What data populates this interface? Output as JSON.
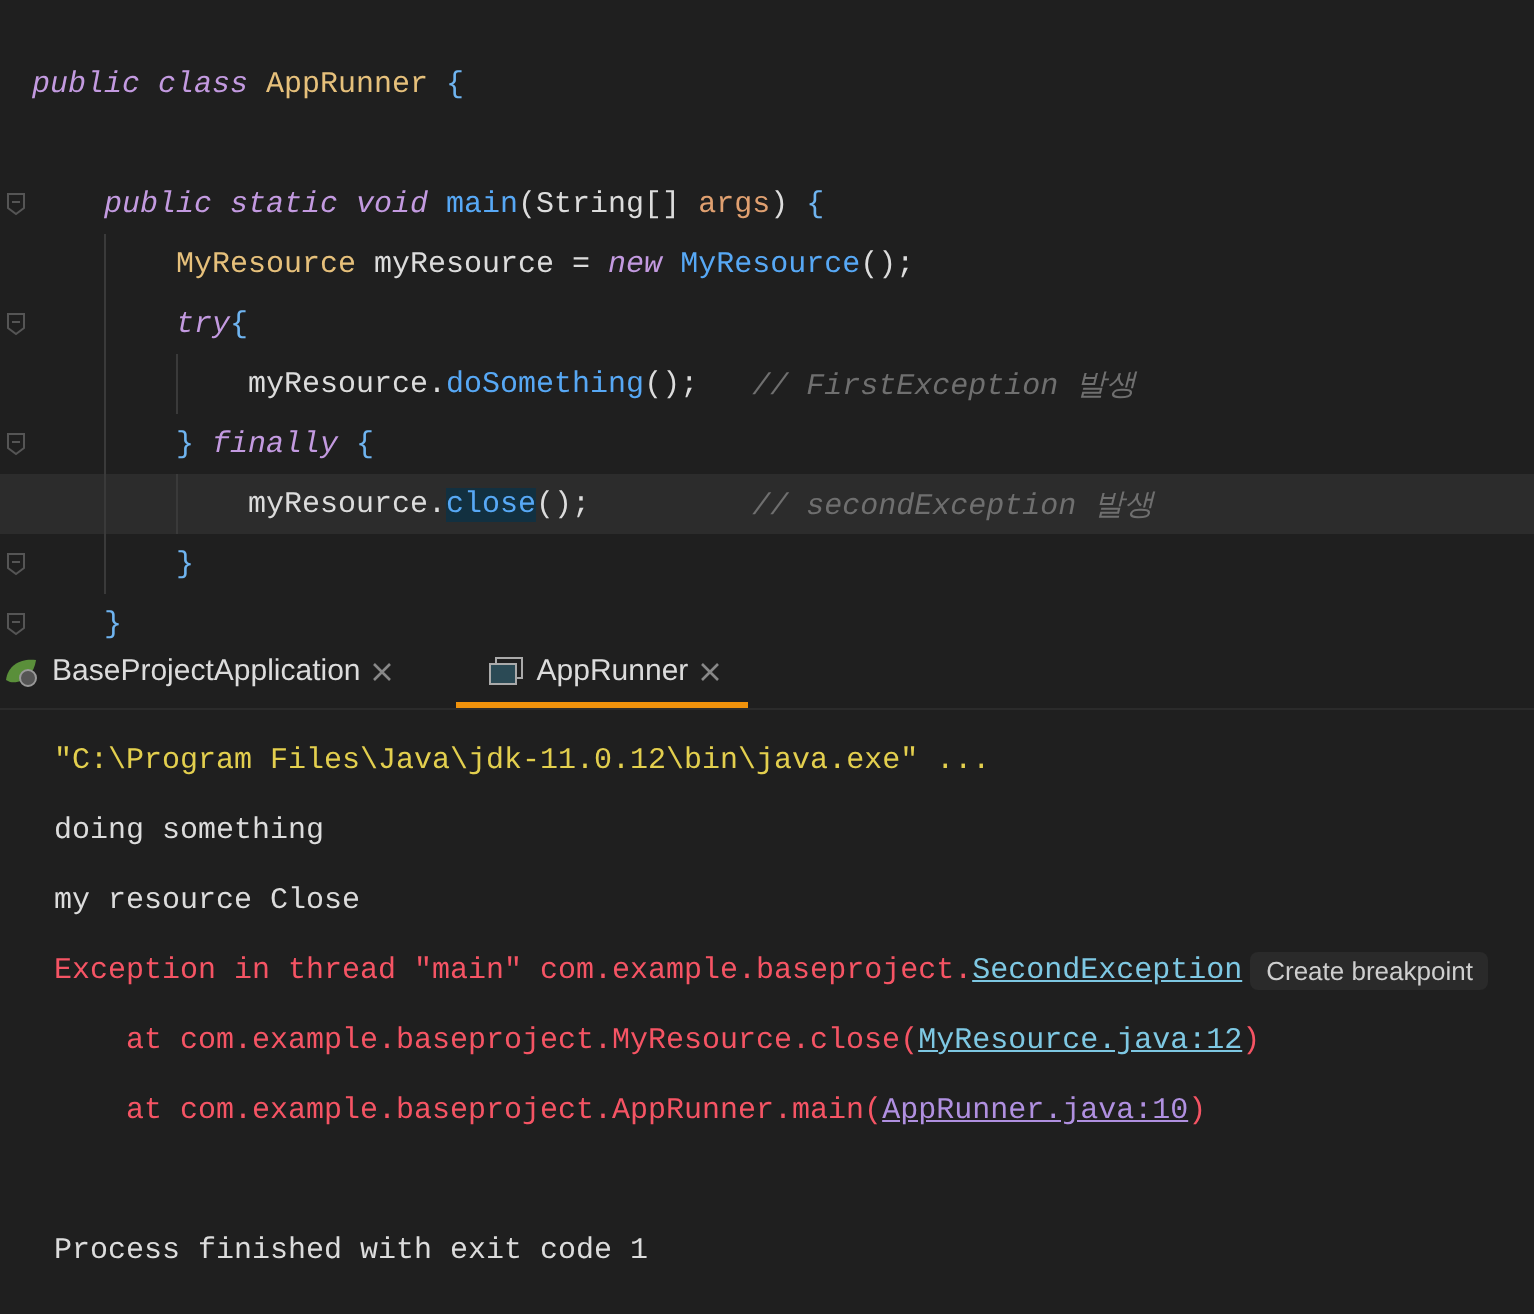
{
  "editor": {
    "lines": [
      {
        "fold": false,
        "current": false,
        "tokens": [
          {
            "kind": "keyword",
            "text": "public class "
          },
          {
            "kind": "class",
            "text": "AppRunner"
          },
          {
            "kind": "brace",
            "text": " {"
          }
        ],
        "children": [
          {
            "fold": false,
            "current": false
          },
          {
            "fold": true,
            "current": false,
            "tokens": [
              {
                "kind": "keyword",
                "text": "public static void "
              },
              {
                "kind": "method",
                "text": "main"
              },
              {
                "kind": "plain",
                "text": "(String[] "
              },
              {
                "kind": "param",
                "text": "args"
              },
              {
                "kind": "plain",
                "text": ") "
              },
              {
                "kind": "brace",
                "text": "{"
              }
            ],
            "children": [
              {
                "fold": false,
                "current": false,
                "tokens": [
                  {
                    "kind": "class",
                    "text": "MyResource"
                  },
                  {
                    "kind": "plain",
                    "text": " myResource = "
                  },
                  {
                    "kind": "keyword",
                    "text": "new "
                  },
                  {
                    "kind": "method",
                    "text": "MyResource"
                  },
                  {
                    "kind": "plain",
                    "text": "();"
                  }
                ]
              },
              {
                "fold": true,
                "current": false,
                "tokens": [
                  {
                    "kind": "keyword",
                    "text": "try"
                  },
                  {
                    "kind": "brace",
                    "text": "{"
                  }
                ],
                "children": [
                  {
                    "fold": false,
                    "current": false,
                    "tokens": [
                      {
                        "kind": "plain",
                        "text": "myResource."
                      },
                      {
                        "kind": "method",
                        "text": "doSomething"
                      },
                      {
                        "kind": "plain",
                        "text": "();   "
                      },
                      {
                        "kind": "comment",
                        "text": "// FirstException 발생"
                      }
                    ]
                  }
                ]
              },
              {
                "fold": true,
                "current": false,
                "tokens": [
                  {
                    "kind": "brace",
                    "text": "} "
                  },
                  {
                    "kind": "keyword",
                    "text": "finally "
                  },
                  {
                    "kind": "brace",
                    "text": "{"
                  }
                ],
                "children": [
                  {
                    "fold": false,
                    "current": true,
                    "tokens": [
                      {
                        "kind": "plain",
                        "text": "myResource."
                      },
                      {
                        "kind": "highlight",
                        "text": "close"
                      },
                      {
                        "kind": "plain",
                        "text": "();         "
                      },
                      {
                        "kind": "comment",
                        "text": "// secondException 발생"
                      }
                    ]
                  }
                ]
              },
              {
                "fold": true,
                "current": false,
                "tokens": [
                  {
                    "kind": "brace",
                    "text": "}"
                  }
                ]
              }
            ]
          },
          {
            "fold": true,
            "current": false,
            "tokens": [
              {
                "kind": "brace",
                "text": "}"
              }
            ]
          }
        ]
      }
    ]
  },
  "tabs": [
    {
      "label": "BaseProjectApplication",
      "kind": "spring",
      "selected": false
    },
    {
      "label": "AppRunner",
      "kind": "app",
      "selected": true
    }
  ],
  "console": {
    "lines": [
      {
        "indent": false,
        "segments": [
          {
            "kind": "command",
            "text": "\"C:\\Program Files\\Java\\jdk-11.0.12\\bin\\java.exe\" ..."
          }
        ]
      },
      {
        "indent": false,
        "segments": [
          {
            "kind": "normal",
            "text": "doing something"
          }
        ]
      },
      {
        "indent": false,
        "segments": [
          {
            "kind": "normal",
            "text": "my resource Close"
          }
        ]
      },
      {
        "indent": false,
        "segments": [
          {
            "kind": "error",
            "text": "Exception in thread \"main\" com.example.baseproject."
          },
          {
            "kind": "link",
            "text": "SecondException"
          }
        ],
        "hint": "Create breakpoint"
      },
      {
        "indent": true,
        "segments": [
          {
            "kind": "error",
            "text": "at com.example.baseproject.MyResource.close("
          },
          {
            "kind": "link",
            "text": "MyResource.java:12"
          },
          {
            "kind": "error",
            "text": ")"
          }
        ]
      },
      {
        "indent": true,
        "segments": [
          {
            "kind": "error",
            "text": "at com.example.baseproject.AppRunner.main("
          },
          {
            "kind": "visited",
            "text": "AppRunner.java:10"
          },
          {
            "kind": "error",
            "text": ")"
          }
        ]
      }
    ],
    "exit_message": "Process finished with exit code 1"
  }
}
